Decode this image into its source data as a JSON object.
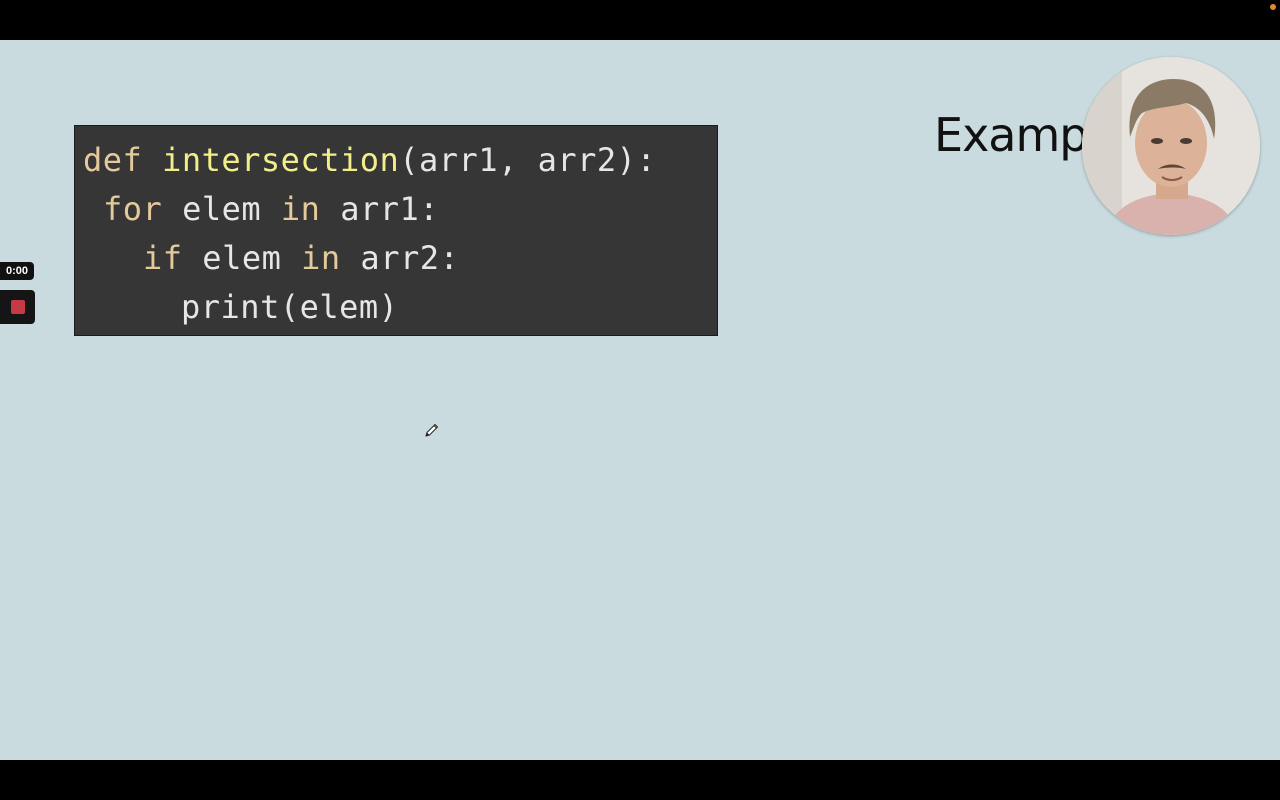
{
  "recording": {
    "timer": "0:00",
    "stop_icon": "stop-square-icon"
  },
  "slide": {
    "title": "Example",
    "background": "#c9dbdf"
  },
  "code": {
    "language": "python",
    "lines": [
      [
        {
          "text": "def ",
          "color": "#e4c99a"
        },
        {
          "text": "intersection",
          "color": "#f2ee8a"
        },
        {
          "text": "(arr1, arr2):",
          "color": "#e6e6e6"
        }
      ],
      [
        {
          "text": "for ",
          "color": "#e4c99a"
        },
        {
          "text": "elem ",
          "color": "#e6e6e6"
        },
        {
          "text": "in ",
          "color": "#e4c99a"
        },
        {
          "text": "arr1:",
          "color": "#e6e6e6"
        }
      ],
      [
        {
          "text": "if ",
          "color": "#e4c99a"
        },
        {
          "text": "elem ",
          "color": "#e6e6e6"
        },
        {
          "text": "in ",
          "color": "#e4c99a"
        },
        {
          "text": "arr2:",
          "color": "#e6e6e6"
        }
      ],
      [
        {
          "text": "print(elem)",
          "color": "#e6e6e6"
        }
      ]
    ]
  },
  "cursor": {
    "icon": "pencil-icon"
  },
  "webcam": {
    "icon": "presenter-avatar"
  }
}
